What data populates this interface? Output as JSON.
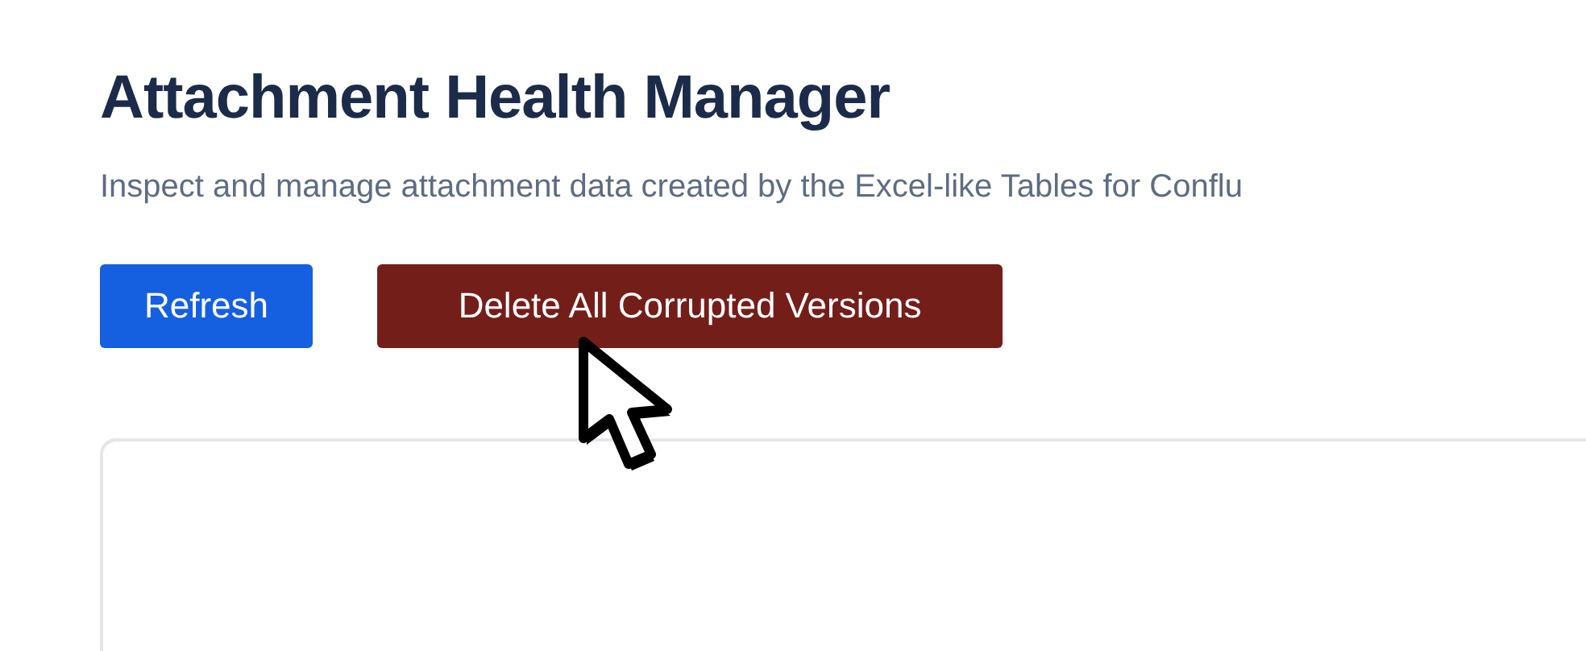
{
  "title": "Attachment Health Manager",
  "subtitle": "Inspect and manage attachment data created by the Excel-like Tables for Conflu",
  "buttons": [
    {
      "label": "Refresh",
      "kind": "primary"
    },
    {
      "label": "Delete All Corrupted Versions",
      "kind": "danger"
    }
  ]
}
